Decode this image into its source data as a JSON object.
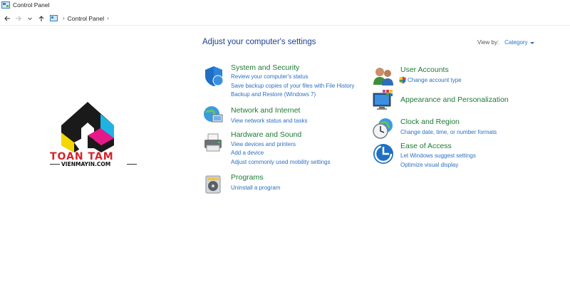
{
  "window": {
    "title": "Control Panel"
  },
  "address": {
    "breadcrumb": "Control Panel"
  },
  "main": {
    "heading": "Adjust your computer's settings",
    "view_by_label": "View by:",
    "view_by_value": "Category"
  },
  "categories": {
    "system_security": {
      "title": "System and Security",
      "links": [
        "Review your computer's status",
        "Save backup copies of your files with File History",
        "Backup and Restore (Windows 7)"
      ]
    },
    "network_internet": {
      "title": "Network and Internet",
      "links": [
        "View network status and tasks"
      ]
    },
    "hardware_sound": {
      "title": "Hardware and Sound",
      "links": [
        "View devices and printers",
        "Add a device",
        "Adjust commonly used mobility settings"
      ]
    },
    "programs": {
      "title": "Programs",
      "links": [
        "Uninstall a program"
      ]
    },
    "user_accounts": {
      "title": "User Accounts",
      "links": [
        "Change account type"
      ]
    },
    "appearance": {
      "title": "Appearance and Personalization"
    },
    "clock_region": {
      "title": "Clock and Region",
      "links": [
        "Change date, time, or number formats"
      ]
    },
    "ease_access": {
      "title": "Ease of Access",
      "links": [
        "Let Windows suggest settings",
        "Optimize visual display"
      ]
    }
  },
  "watermark": {
    "text": "TOAN TAM",
    "sub": "VIENMAYIN.COM"
  },
  "colors": {
    "heading": "#1c3f8f",
    "category_title": "#1e7a34",
    "link": "#2b6fc0",
    "logo_red": "#d6232a"
  },
  "icons": {
    "back": "arrow-left-icon",
    "forward": "arrow-right-icon",
    "recent": "chevron-down-icon",
    "up": "arrow-up-icon"
  }
}
